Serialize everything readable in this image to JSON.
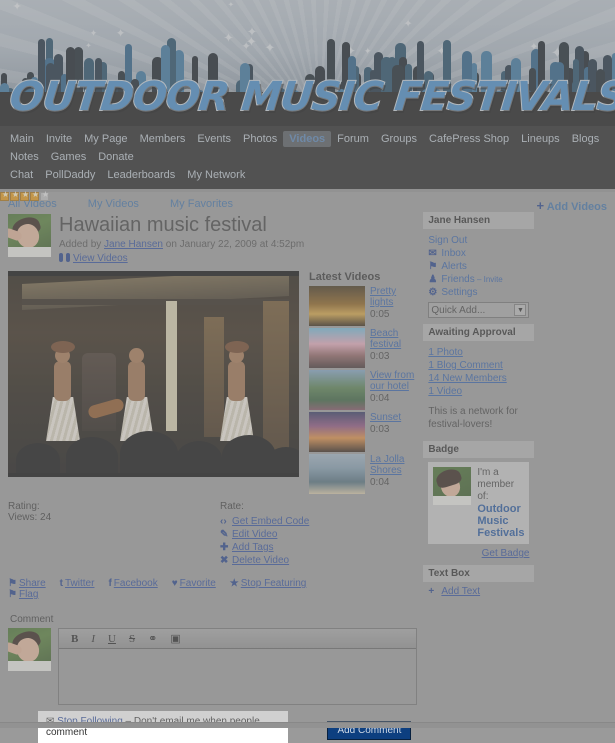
{
  "site": {
    "logo_text": "OUTDOOR MUSIC FESTIVALS"
  },
  "mainnav": {
    "items": [
      {
        "label": "Main",
        "active": false
      },
      {
        "label": "Invite",
        "active": false
      },
      {
        "label": "My Page",
        "active": false
      },
      {
        "label": "Members",
        "active": false
      },
      {
        "label": "Events",
        "active": false
      },
      {
        "label": "Photos",
        "active": false
      },
      {
        "label": "Videos",
        "active": true
      },
      {
        "label": "Forum",
        "active": false
      },
      {
        "label": "Groups",
        "active": false
      },
      {
        "label": "CafePress Shop",
        "active": false
      },
      {
        "label": "Lineups",
        "active": false
      },
      {
        "label": "Blogs",
        "active": false
      },
      {
        "label": "Notes",
        "active": false
      },
      {
        "label": "Games",
        "active": false
      },
      {
        "label": "Donate",
        "active": false
      },
      {
        "label": "Chat",
        "active": false
      },
      {
        "label": "PollDaddy",
        "active": false
      },
      {
        "label": "Leaderboards",
        "active": false
      },
      {
        "label": "My Network",
        "active": false
      }
    ]
  },
  "subnav": {
    "items": [
      {
        "label": "All Videos"
      },
      {
        "label": "My Videos"
      },
      {
        "label": "My Favorites"
      }
    ],
    "add_videos": "Add Videos",
    "add_icon": "plus-icon"
  },
  "video": {
    "title": "Hawaiian music festival",
    "added_prefix": "Added by",
    "author": "Jane Hansen",
    "added_suffix": "on January 22, 2009 at 4:52pm",
    "view_videos": "View Videos",
    "view_videos_icon": "binoculars-icon",
    "rating_label": "Rating:",
    "rating_stars": 4,
    "rating_max": 5,
    "views_label": "Views: 24",
    "rate_label": "Rate:",
    "rate_stars": 4,
    "rate_max": 5,
    "actions": [
      {
        "label": "Get Embed Code",
        "icon": "code-icon",
        "glyph": "‹›"
      },
      {
        "label": "Edit Video",
        "icon": "pencil-icon",
        "glyph": "✎"
      },
      {
        "label": "Add Tags",
        "icon": "plus-icon",
        "glyph": "✚"
      },
      {
        "label": "Delete Video",
        "icon": "close-icon",
        "glyph": "✖"
      }
    ],
    "share": [
      {
        "label": "Share",
        "icon": "share-icon",
        "glyph": "⚑"
      },
      {
        "label": "Twitter",
        "icon": "twitter-icon",
        "glyph": "t"
      },
      {
        "label": "Facebook",
        "icon": "facebook-icon",
        "glyph": "f"
      },
      {
        "label": "Favorite",
        "icon": "heart-icon",
        "glyph": "♥"
      },
      {
        "label": "Stop Featuring",
        "icon": "star-icon",
        "glyph": "★"
      },
      {
        "label": "Flag",
        "icon": "flag-icon",
        "glyph": "⚑"
      }
    ]
  },
  "latest_videos": {
    "heading": "Latest Videos",
    "items": [
      {
        "title": "Pretty lights",
        "duration": "0:05",
        "thumb": "city-lights-night"
      },
      {
        "title": "Beach festival",
        "duration": "0:03",
        "thumb": "beach-crowd-pink-building"
      },
      {
        "title": "View from our hotel",
        "duration": "0:04",
        "thumb": "green-hillside-flowers"
      },
      {
        "title": "Sunset",
        "duration": "0:03",
        "thumb": "orange-purple-sunset"
      },
      {
        "title": "La Jolla Shores",
        "duration": "0:04",
        "thumb": "coastline-ocean"
      }
    ]
  },
  "comment": {
    "label": "Comment",
    "toolbar": [
      {
        "name": "bold-icon",
        "glyph": "B"
      },
      {
        "name": "italic-icon",
        "glyph": "I"
      },
      {
        "name": "underline-icon",
        "glyph": "U"
      },
      {
        "name": "strikethrough-icon",
        "glyph": "S"
      },
      {
        "name": "link-icon",
        "glyph": "⚭"
      },
      {
        "name": "image-icon",
        "glyph": "▣"
      }
    ],
    "textarea_value": "",
    "textarea_placeholder": "",
    "follow_link": "Stop Following",
    "follow_note": "– Don't email me when people comment",
    "follow_icon": "email-icon",
    "submit_label": "Add Comment"
  },
  "sidebar": {
    "user": {
      "name": "Jane Hansen",
      "sign_out": "Sign Out",
      "links": [
        {
          "label": "Inbox",
          "icon": "envelope-icon",
          "glyph": "✉"
        },
        {
          "label": "Alerts",
          "icon": "flag-icon",
          "glyph": "⚑"
        },
        {
          "label": "Friends",
          "icon": "person-icon",
          "glyph": "♟",
          "suffix": "– Invite"
        },
        {
          "label": "Settings",
          "icon": "gear-icon",
          "glyph": "⚙"
        }
      ],
      "quick_add": "Quick Add...",
      "quick_add_caret": "chevron-down-icon"
    },
    "approval": {
      "heading": "Awaiting Approval",
      "items": [
        "1 Photo",
        "1 Blog Comment",
        "14 New Members",
        "1 Video"
      ]
    },
    "network_description": "This is a network for festival-lovers!",
    "badge": {
      "heading": "Badge",
      "line1": "I'm a member of:",
      "line2": "Outdoor Music Festivals",
      "get_badge": "Get Badge"
    },
    "textbox": {
      "heading": "Text Box",
      "add_text": "Add Text",
      "add_icon": "plus-icon"
    }
  },
  "colors": {
    "link": "#2a5aa8",
    "link_dark": "#27479b",
    "nav_bg": "#1b1b1b",
    "page_bg": "#9a9a9a",
    "accent": "#0d3f80",
    "star_on": "#e8960c"
  }
}
